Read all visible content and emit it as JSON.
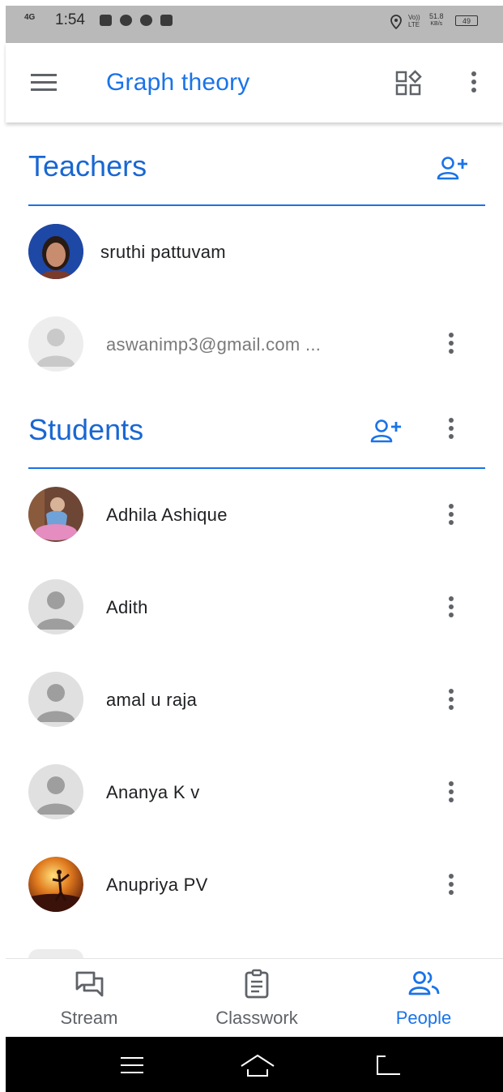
{
  "status": {
    "network": "4G",
    "time": "1:54",
    "volte": "Vo)) LTE",
    "speed": "51.8",
    "speed_unit": "KB/s",
    "battery": "49"
  },
  "appbar": {
    "title": "Graph theory"
  },
  "teachers": {
    "title": "Teachers",
    "items": [
      {
        "name": "sruthi pattuvam"
      },
      {
        "name": "aswanimp3@gmail.com ..."
      }
    ]
  },
  "students": {
    "title": "Students",
    "items": [
      {
        "name": "Adhila Ashique"
      },
      {
        "name": "Adith"
      },
      {
        "name": "amal u raja"
      },
      {
        "name": "Ananya K v"
      },
      {
        "name": "Anupriya PV"
      }
    ]
  },
  "bottom_nav": {
    "tabs": [
      {
        "label": "Stream"
      },
      {
        "label": "Classwork"
      },
      {
        "label": "People"
      }
    ]
  },
  "colors": {
    "accent": "#1a73e8",
    "status_bar": "#b9b9b9",
    "icon_grey": "#5f6368"
  }
}
